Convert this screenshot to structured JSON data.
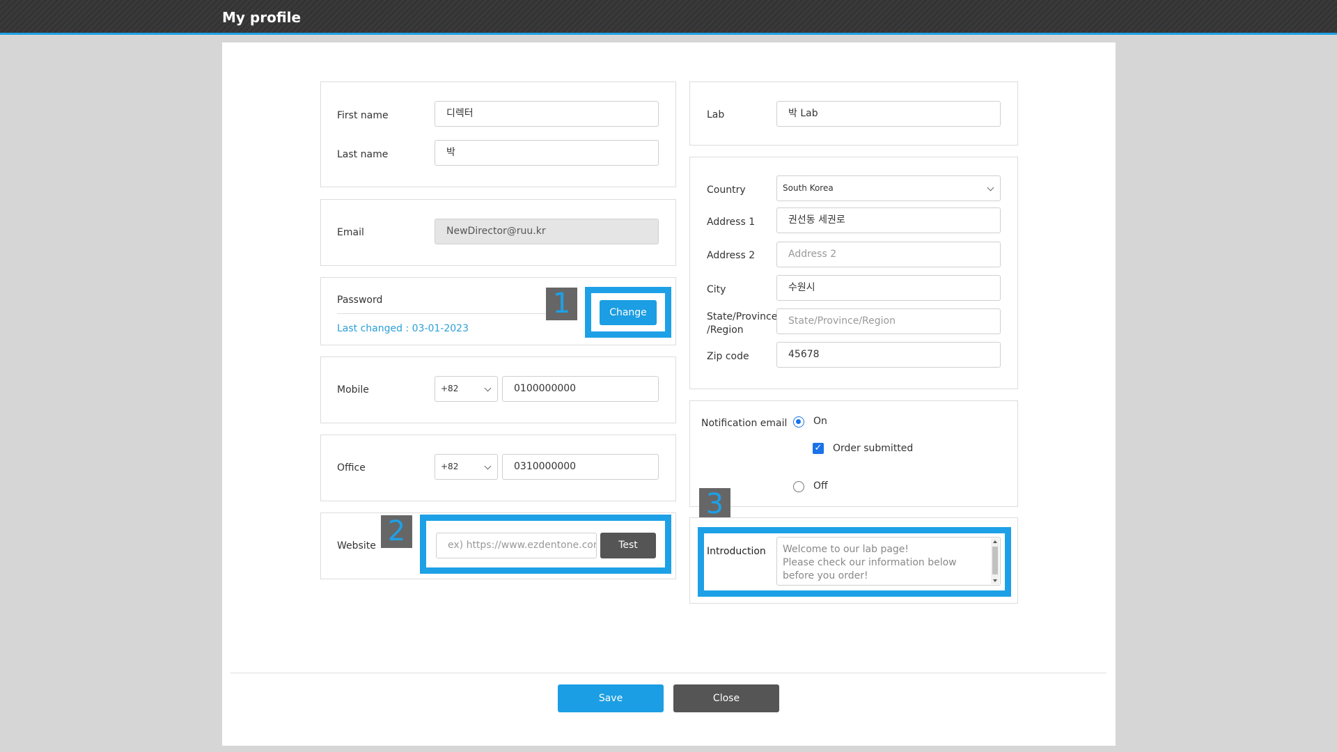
{
  "header": {
    "title": "My profile"
  },
  "name": {
    "first_label": "First name",
    "first_value": "디렉터",
    "last_label": "Last name",
    "last_value": "박"
  },
  "email": {
    "label": "Email",
    "value": "NewDirector@ruu.kr"
  },
  "password": {
    "label": "Password",
    "last_changed": "Last changed : 03-01-2023",
    "change_label": "Change"
  },
  "mobile": {
    "label": "Mobile",
    "code": "+82",
    "number": "0100000000"
  },
  "office": {
    "label": "Office",
    "code": "+82",
    "number": "0310000000"
  },
  "website": {
    "label": "Website",
    "placeholder": "ex) https://www.ezdentone.com",
    "test_label": "Test"
  },
  "lab": {
    "label": "Lab",
    "value": "박 Lab"
  },
  "address": {
    "country_label": "Country",
    "country_value": "South Korea",
    "address1_label": "Address 1",
    "address1_value": "권선동 세권로",
    "address2_label": "Address 2",
    "address2_placeholder": "Address 2",
    "city_label": "City",
    "city_value": "수원시",
    "state_label_1": "State/Province",
    "state_label_2": "/Region",
    "state_placeholder": "State/Province/Region",
    "zip_label": "Zip code",
    "zip_value": "45678"
  },
  "notification": {
    "label": "Notification email",
    "on_label": "On",
    "order_label": "Order submitted",
    "off_label": "Off",
    "selected": "On",
    "order_submitted_checked": true
  },
  "introduction": {
    "label": "Introduction",
    "text": "Welcome to our lab page!\nPlease check our information below before you order!"
  },
  "badges": {
    "one": "1",
    "two": "2",
    "three": "3"
  },
  "footer": {
    "save_label": "Save",
    "close_label": "Close"
  },
  "colors": {
    "accent": "#1ea0e6",
    "button_blue": "#1b9ee3",
    "button_dark": "#555555",
    "header_bg": "#333333"
  }
}
